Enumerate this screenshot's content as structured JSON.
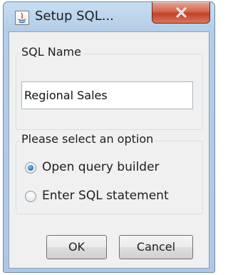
{
  "window": {
    "title": "Setup SQL..."
  },
  "sql_name": {
    "legend": "SQL Name",
    "value": "Regional Sales"
  },
  "options": {
    "legend": "Please select an option",
    "items": [
      {
        "label": "Open query builder",
        "checked": true
      },
      {
        "label": "Enter SQL statement",
        "checked": false
      }
    ]
  },
  "buttons": {
    "ok_label": "OK",
    "cancel_label": "Cancel"
  },
  "icons": {
    "app": "java-app-icon",
    "close": "close-icon"
  },
  "colors": {
    "close_button": "#c24128",
    "title_bar": "#b4cde8",
    "dialog_background": "#f0f0f0"
  }
}
